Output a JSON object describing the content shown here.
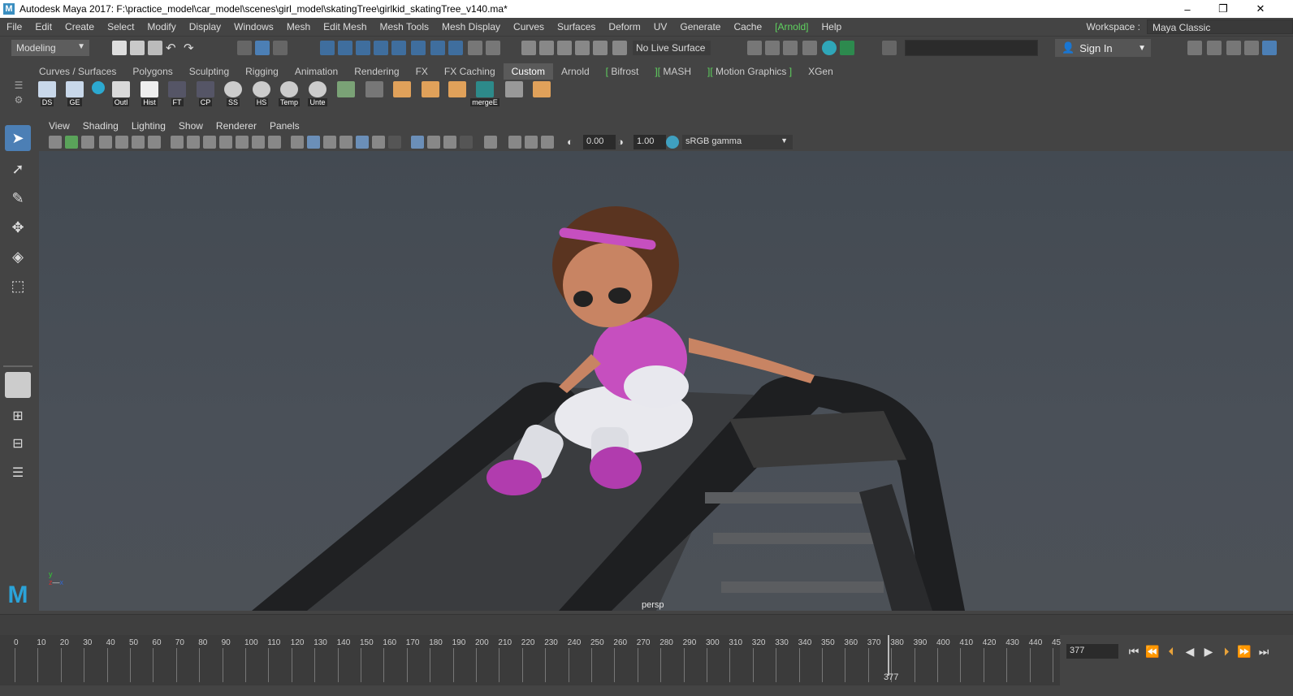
{
  "window": {
    "title": "Autodesk Maya 2017: F:\\practice_model\\car_model\\scenes\\girl_model\\skatingTree\\girlkid_skatingTree_v140.ma*",
    "logo_letter": "M",
    "controls": [
      "–",
      "❐",
      "✕"
    ]
  },
  "menubar": {
    "items": [
      "File",
      "Edit",
      "Create",
      "Select",
      "Modify",
      "Display",
      "Windows",
      "Mesh",
      "Edit Mesh",
      "Mesh Tools",
      "Mesh Display",
      "Curves",
      "Surfaces",
      "Deform",
      "UV",
      "Generate",
      "Cache",
      "[Arnold]",
      "Help"
    ],
    "workspace_label": "Workspace :",
    "workspace_value": "Maya Classic"
  },
  "statusline": {
    "mode": "Modeling",
    "live_surface": "No Live Surface",
    "sign_in": "Sign In"
  },
  "shelf": {
    "tabs": [
      "Curves / Surfaces",
      "Polygons",
      "Sculpting",
      "Rigging",
      "Animation",
      "Rendering",
      "FX",
      "FX Caching",
      "Custom",
      "Arnold"
    ],
    "bracket_tabs": [
      "Bifrost",
      "MASH",
      "Motion Graphics"
    ],
    "tail_tab": "XGen",
    "active_tab": "Custom",
    "buttons": [
      "DS",
      "GE",
      "",
      "Outl",
      "Hist",
      "FT",
      "CP",
      "SS",
      "HS",
      "Temp",
      "Unte",
      "",
      "",
      "",
      "",
      "",
      "mergeE",
      "",
      ""
    ]
  },
  "panel": {
    "menu": [
      "View",
      "Shading",
      "Lighting",
      "Show",
      "Renderer",
      "Panels"
    ],
    "exposure": "0.00",
    "gamma": "1.00",
    "color_space": "sRGB gamma",
    "camera": "persp"
  },
  "timeline": {
    "ticks": [
      "0",
      "10",
      "20",
      "30",
      "40",
      "50",
      "60",
      "70",
      "80",
      "90",
      "100",
      "110",
      "120",
      "130",
      "140",
      "150",
      "160",
      "170",
      "180",
      "190",
      "200",
      "210",
      "220",
      "230",
      "240",
      "250",
      "260",
      "270",
      "280",
      "290",
      "300",
      "310",
      "320",
      "330",
      "340",
      "350",
      "360",
      "370",
      "380",
      "390",
      "400",
      "410",
      "420",
      "430",
      "440",
      "45"
    ],
    "current_frame": "377",
    "current_frame_marker": "377"
  },
  "colors": {
    "accent": "#5fd35f",
    "active_tool": "#4c7fb5"
  }
}
